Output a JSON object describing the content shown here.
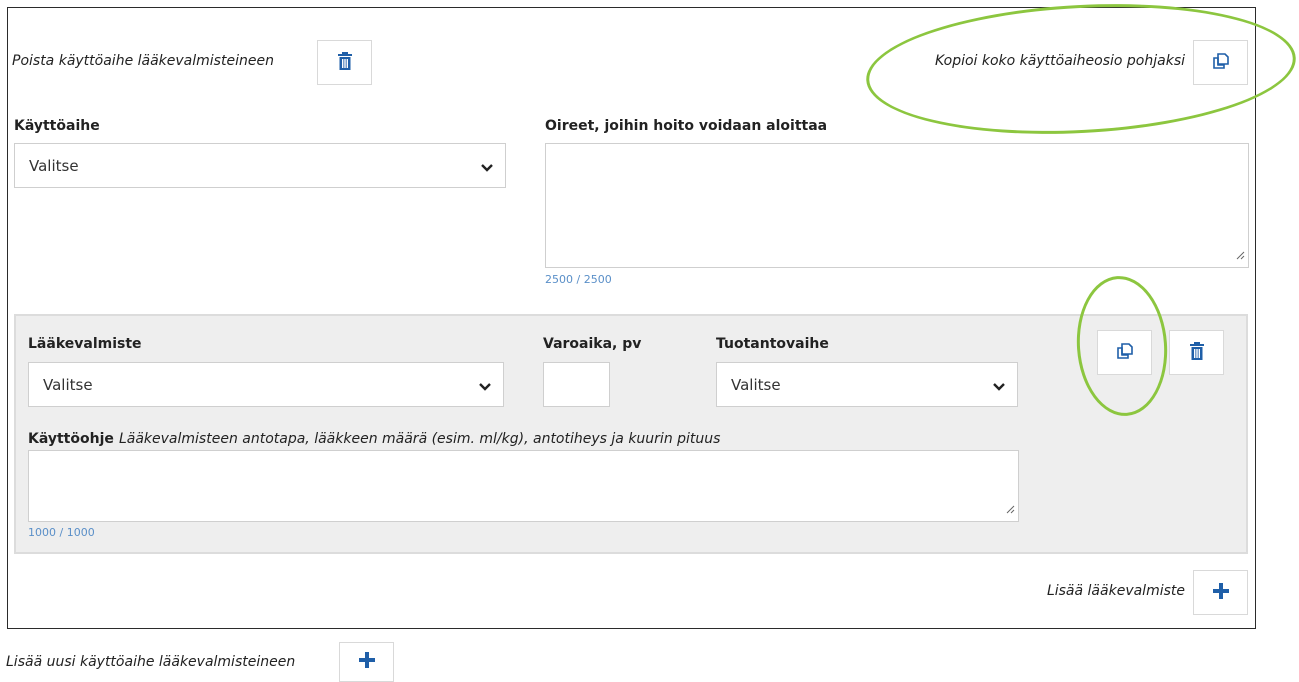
{
  "indication": {
    "delete_label": "Poista käyttöaihe lääkevalmisteineen",
    "copy_label": "Kopioi koko käyttöaiheosio pohjaksi",
    "indication_label": "Käyttöaihe",
    "indication_select_value": "Valitse",
    "symptoms_label": "Oireet, joihin hoito voidaan aloittaa",
    "symptoms_value": "",
    "symptoms_counter": "2500 / 2500"
  },
  "product": {
    "product_label": "Lääkevalmiste",
    "product_select_value": "Valitse",
    "withdrawal_label": "Varoaika, pv",
    "withdrawal_value": "",
    "production_label": "Tuotantovaihe",
    "production_select_value": "Valitse",
    "instructions_label": "Käyttöohje",
    "instructions_hint": "Lääkevalmisteen antotapa, lääkkeen määrä (esim. ml/kg), antotiheys ja kuurin pituus",
    "instructions_value": "",
    "instructions_counter": "1000 / 1000"
  },
  "add_product_label": "Lisää lääkevalmiste",
  "add_indication_label": "Lisää uusi käyttöaihe lääkevalmisteineen",
  "colors": {
    "accent_blue": "#1f5fa8",
    "highlight_green": "#8cc63f",
    "counter_blue": "#5a8fc8"
  },
  "icons": {
    "delete": "trash-icon",
    "copy": "copy-icon",
    "add": "plus-icon",
    "dropdown": "chevron-down-icon"
  }
}
